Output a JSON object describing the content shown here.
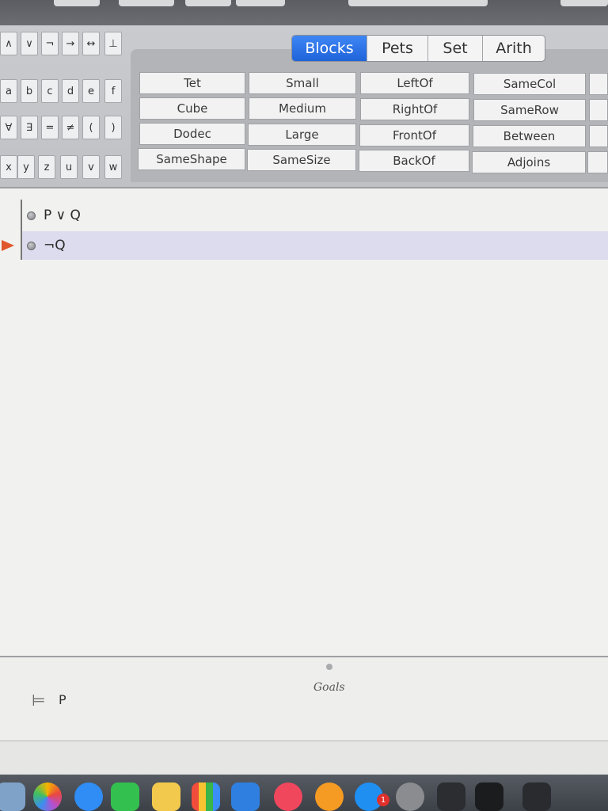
{
  "keypad": {
    "row1": [
      "∧",
      "∨",
      "¬",
      "→",
      "↔",
      "⊥"
    ],
    "row2": [
      "a",
      "b",
      "c",
      "d",
      "e",
      "f"
    ],
    "row3": [
      "∀",
      "∃",
      "=",
      "≠",
      "(",
      ")"
    ],
    "row4": [
      "x",
      "y",
      "z",
      "u",
      "v",
      "w"
    ]
  },
  "tabs": [
    "Blocks",
    "Pets",
    "Set",
    "Arith"
  ],
  "predicates": {
    "col1": [
      "Tet",
      "Cube",
      "Dodec",
      "SameShape"
    ],
    "col2": [
      "Small",
      "Medium",
      "Large",
      "SameSize"
    ],
    "col3": [
      "LeftOf",
      "RightOf",
      "FrontOf",
      "BackOf"
    ],
    "col4": [
      "SameCol",
      "SameRow",
      "Between",
      "Adjoins"
    ]
  },
  "proof": {
    "premise": "P ∨ Q",
    "step": "¬Q"
  },
  "goals": {
    "label": "Goals",
    "turnstile": "⊨",
    "goal": "P"
  },
  "dock": {
    "badge": "1"
  }
}
